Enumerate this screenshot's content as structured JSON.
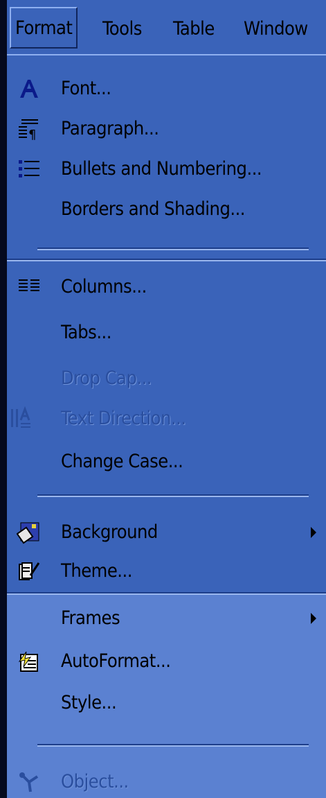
{
  "menubar": {
    "items": [
      {
        "label": "Format"
      },
      {
        "label": "Tools"
      },
      {
        "label": "Table"
      },
      {
        "label": "Window"
      }
    ]
  },
  "menu": {
    "items": [
      {
        "label": "Font...",
        "icon": "font-icon",
        "enabled": true
      },
      {
        "label": "Paragraph...",
        "icon": "paragraph-icon",
        "enabled": true
      },
      {
        "label": "Bullets and Numbering...",
        "icon": "bullets-icon",
        "enabled": true
      },
      {
        "label": "Borders and Shading...",
        "icon": "",
        "enabled": true
      },
      {
        "label": "Columns...",
        "icon": "columns-icon",
        "enabled": true
      },
      {
        "label": "Tabs...",
        "icon": "",
        "enabled": true
      },
      {
        "label": "Drop Cap...",
        "icon": "",
        "enabled": false
      },
      {
        "label": "Text Direction...",
        "icon": "text-direction-icon",
        "enabled": false
      },
      {
        "label": "Change Case...",
        "icon": "",
        "enabled": true
      },
      {
        "label": "Background",
        "icon": "background-icon",
        "enabled": true,
        "submenu": true
      },
      {
        "label": "Theme...",
        "icon": "theme-icon",
        "enabled": true
      },
      {
        "label": "Frames",
        "icon": "",
        "enabled": true,
        "submenu": true
      },
      {
        "label": "AutoFormat...",
        "icon": "autoformat-icon",
        "enabled": true
      },
      {
        "label": "Style...",
        "icon": "",
        "enabled": true
      },
      {
        "label": "Object...",
        "icon": "object-icon",
        "enabled": false
      }
    ]
  },
  "colors": {
    "menu_bg": "#3a63b9",
    "menu_bg_light": "#5b81d1",
    "disabled_text": "#2a4e9e",
    "frame_dark": "#0a0f2a"
  }
}
